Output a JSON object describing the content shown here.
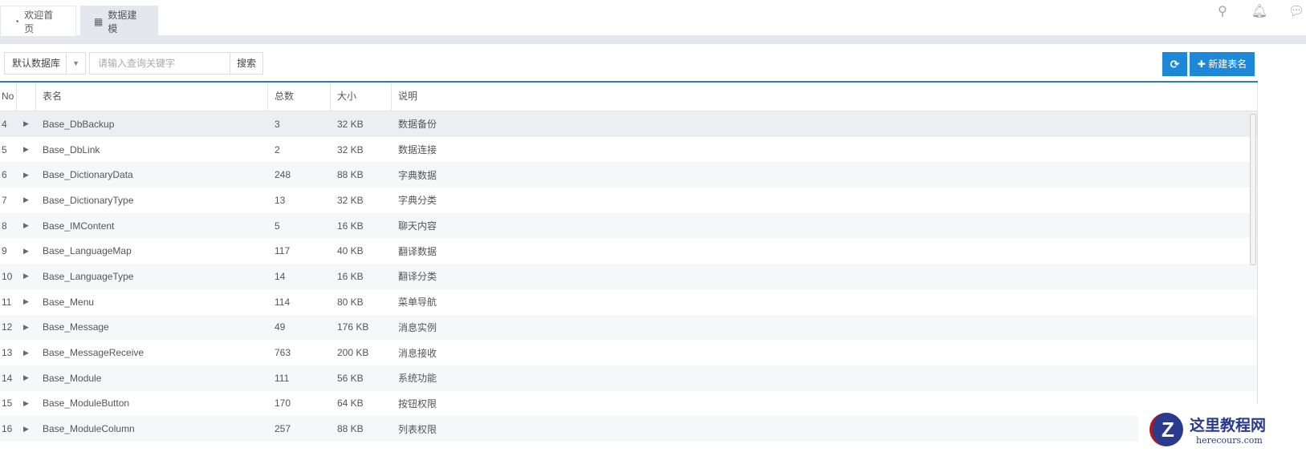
{
  "tabs": [
    {
      "label": "欢迎首页",
      "icon": "dashboard-icon"
    },
    {
      "label": "数据建模",
      "icon": "table-icon"
    }
  ],
  "toolbar": {
    "database": "默认数据库",
    "search_placeholder": "请输入查询关键字",
    "search_label": "搜索",
    "new_label": "新建表名"
  },
  "columns": [
    "No",
    "",
    "表名",
    "总数",
    "大小",
    "说明"
  ],
  "rows": [
    {
      "no": "4",
      "name": "Base_DbBackup",
      "count": "3",
      "size": "32 KB",
      "desc": "数据备份"
    },
    {
      "no": "5",
      "name": "Base_DbLink",
      "count": "2",
      "size": "32 KB",
      "desc": "数据连接"
    },
    {
      "no": "6",
      "name": "Base_DictionaryData",
      "count": "248",
      "size": "88 KB",
      "desc": "字典数据"
    },
    {
      "no": "7",
      "name": "Base_DictionaryType",
      "count": "13",
      "size": "32 KB",
      "desc": "字典分类"
    },
    {
      "no": "8",
      "name": "Base_IMContent",
      "count": "5",
      "size": "16 KB",
      "desc": "聊天内容"
    },
    {
      "no": "9",
      "name": "Base_LanguageMap",
      "count": "117",
      "size": "40 KB",
      "desc": "翻译数据"
    },
    {
      "no": "10",
      "name": "Base_LanguageType",
      "count": "14",
      "size": "16 KB",
      "desc": "翻译分类"
    },
    {
      "no": "11",
      "name": "Base_Menu",
      "count": "114",
      "size": "80 KB",
      "desc": "菜单导航"
    },
    {
      "no": "12",
      "name": "Base_Message",
      "count": "49",
      "size": "176 KB",
      "desc": "消息实例"
    },
    {
      "no": "13",
      "name": "Base_MessageReceive",
      "count": "763",
      "size": "200 KB",
      "desc": "消息接收"
    },
    {
      "no": "14",
      "name": "Base_Module",
      "count": "111",
      "size": "56 KB",
      "desc": "系统功能"
    },
    {
      "no": "15",
      "name": "Base_ModuleButton",
      "count": "170",
      "size": "64 KB",
      "desc": "按钮权限"
    },
    {
      "no": "16",
      "name": "Base_ModuleColumn",
      "count": "257",
      "size": "88 KB",
      "desc": "列表权限"
    }
  ],
  "watermark": {
    "title": "这里教程网",
    "url": "herecours.com"
  },
  "accent": "#1e88d8"
}
